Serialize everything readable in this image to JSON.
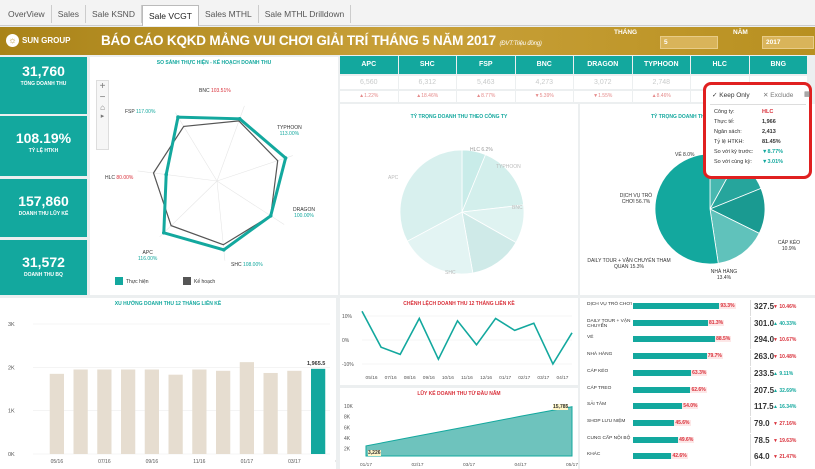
{
  "tabs": [
    {
      "label": "OverView"
    },
    {
      "label": "Sales"
    },
    {
      "label": "Sale KSND"
    },
    {
      "label": "Sale VCGT",
      "active": true
    },
    {
      "label": "Sales MTHL"
    },
    {
      "label": "Sale MTHL Drilldown"
    }
  ],
  "header": {
    "logo_text": "SUN GROUP",
    "title": "BÁO CÁO KQKD MẢNG VUI CHƠI GIẢI TRÍ THÁNG 5 NĂM 2017",
    "unit": "(ĐVT:Triệu đồng)",
    "filter_month_label": "THÁNG",
    "filter_month_value": "5",
    "filter_year_label": "NĂM",
    "filter_year_value": "2017"
  },
  "kpis": [
    {
      "value": "31,760",
      "label": "TỔNG DOANH THU"
    },
    {
      "value": "108.19%",
      "label": "TỶ LỆ HTKH"
    },
    {
      "value": "157,860",
      "label": "DOANH THU LŨY KẾ"
    },
    {
      "value": "31,572",
      "label": "DOANH THU BQ"
    }
  ],
  "radar": {
    "title": "SO SÁNH THỰC HIỆN - KẾ HOẠCH DOANH THU",
    "legend_actual": "Thực hiện",
    "legend_plan": "Kế hoạch",
    "accent": "#13a89e",
    "plan_color": "#555555",
    "points": [
      {
        "name": "BNC",
        "value": "103.51%"
      },
      {
        "name": "TYPHOON",
        "value": "113.00%"
      },
      {
        "name": "DRAGON",
        "value": "100.00%"
      },
      {
        "name": "SHC",
        "value": "108.00%"
      },
      {
        "name": "APC",
        "value": "116.00%"
      },
      {
        "name": "HLC",
        "value": "80.00%"
      },
      {
        "name": "FSP",
        "value": "117.00%"
      }
    ]
  },
  "company_columns": [
    {
      "name": "APC",
      "value": "6,560",
      "pct": "▲1.22%"
    },
    {
      "name": "SHC",
      "value": "6,312",
      "pct": "▲18.46%"
    },
    {
      "name": "FSP",
      "value": "5,463",
      "pct": "▲8.77%"
    },
    {
      "name": "BNC",
      "value": "4,273",
      "pct": "▼5.39%"
    },
    {
      "name": "DRAGON",
      "value": "3,072",
      "pct": "▼1.55%"
    },
    {
      "name": "TYPHOON",
      "value": "2,748",
      "pct": "▲8.46%"
    },
    {
      "name": "HLC",
      "value": "",
      "pct": ""
    },
    {
      "name": "BNG",
      "value": "",
      "pct": ""
    }
  ],
  "pie_company": {
    "title": "TỶ TRỌNG DOANH THU THEO CÔNG TY",
    "labels": [
      "HLC 6.2%",
      "FSP",
      "TYPHOON",
      "BNC",
      "SHC",
      "APC"
    ]
  },
  "pie_category": {
    "title": "TỶ TRỌNG DOANH THU",
    "labels": [
      {
        "text": "VÉ 8.0%"
      },
      {
        "text": "DỊCH VỤ TRÒ CHƠI 56.7%"
      },
      {
        "text": "CÁP KÉO 10.9%"
      },
      {
        "text": "NHÀ HÀNG 13.4%"
      },
      {
        "text": "DAILY TOUR + VẬN CHUYỂN THAM QUAN 15.3%"
      }
    ]
  },
  "tooltip": {
    "keep_only": "✓ Keep Only",
    "exclude": "✕ Exclude",
    "rows": [
      {
        "label": "Công ty:",
        "value": "HLC",
        "color": "#d9303a"
      },
      {
        "label": "Thực tế:",
        "value": "1,966",
        "color": "#333"
      },
      {
        "label": "Ngân sách:",
        "value": "2,413",
        "color": "#333"
      },
      {
        "label": "Tỷ lệ HTKH:",
        "value": "81.45%",
        "color": "#333"
      },
      {
        "label": "So với kỳ trước:",
        "value": "▼8.77%",
        "color": "#13a89e"
      },
      {
        "label": "So với cùng kỳ:",
        "value": "▼3.01%",
        "color": "#13a89e"
      }
    ]
  },
  "trend12": {
    "title": "XU HƯỚNG DOANH THU 12 THÁNG LIÊN KỀ",
    "y_ticks": [
      "3K",
      "2K",
      "1K",
      "0K"
    ],
    "months": [
      "05/16",
      "07/16",
      "09/16",
      "11/16",
      "01/17",
      "03/17",
      "05/17"
    ],
    "last_value": "1,965.5",
    "bar_color": "#e6ddd0",
    "highlight_color": "#13a89e"
  },
  "diff12": {
    "title": "CHÊNH LỆCH DOANH THU 12 THÁNG LIÊN KỀ",
    "y_ticks": [
      "10%",
      "0%",
      "-10%"
    ],
    "months": [
      "05/16",
      "07/16",
      "08/16",
      "09/16",
      "10/16",
      "11/16",
      "12/16",
      "01/17",
      "02/17",
      "03/17",
      "04/17"
    ]
  },
  "cumulative": {
    "title": "LŨY KẾ DOANH THU TỪ ĐẦU NĂM",
    "y_ticks": [
      "10K",
      "8K",
      "6K",
      "4K",
      "2K"
    ],
    "start_label": "3,226",
    "end_label": "15,785",
    "months": [
      "01/17",
      "02/17",
      "03/17",
      "04/17",
      "05/17"
    ]
  },
  "category_bars": [
    {
      "label": "DỊCH VỤ TRÒ CHƠI",
      "pct": "93.3%",
      "value": "327.5",
      "change": "▼ 10.46%",
      "dir": "down",
      "frac": 0.93
    },
    {
      "label": "DAILY TOUR + VẬN CHUYỂN",
      "pct": "81.3%",
      "value": "301.0",
      "change": "▲ 40.33%",
      "dir": "up",
      "frac": 0.81
    },
    {
      "label": "VÉ",
      "pct": "88.5%",
      "value": "294.0",
      "change": "▼ 10.67%",
      "dir": "down",
      "frac": 0.885
    },
    {
      "label": "NHÀ HÀNG",
      "pct": "79.7%",
      "value": "263.0",
      "change": "▼ 10.48%",
      "dir": "down",
      "frac": 0.797
    },
    {
      "label": "CÁP KÉO",
      "pct": "63.3%",
      "value": "233.5",
      "change": "▲ 9.11%",
      "dir": "up",
      "frac": 0.633
    },
    {
      "label": "CÁP TREO",
      "pct": "62.6%",
      "value": "207.5",
      "change": "▲ 32.69%",
      "dir": "up",
      "frac": 0.626
    },
    {
      "label": "SẢI TÂM",
      "pct": "54.0%",
      "value": "117.5",
      "change": "▲ 16.34%",
      "dir": "up",
      "frac": 0.54
    },
    {
      "label": "SHOP LƯU NIỆM",
      "pct": "45.6%",
      "value": "79.0",
      "change": "▼ 27.16%",
      "dir": "down",
      "frac": 0.456
    },
    {
      "label": "CUNG CẤP NỘI BỘ",
      "pct": "49.6%",
      "value": "78.5",
      "change": "▼ 19.63%",
      "dir": "down",
      "frac": 0.496
    },
    {
      "label": "KHÁC",
      "pct": "42.6%",
      "value": "64.0",
      "change": "▼ 21.47%",
      "dir": "down",
      "frac": 0.426
    }
  ]
}
